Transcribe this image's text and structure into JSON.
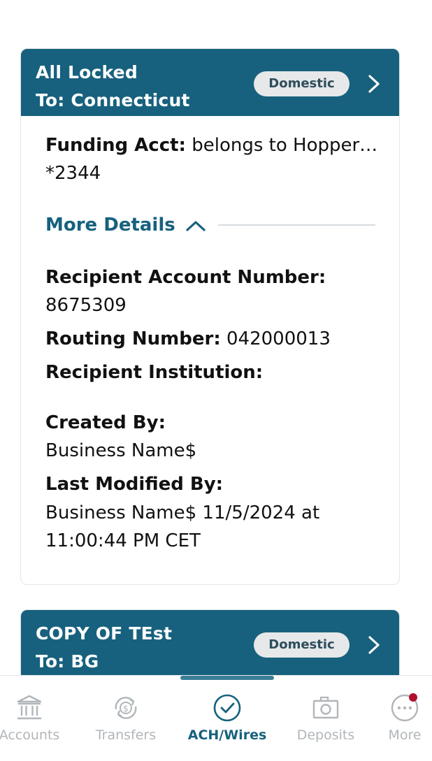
{
  "cards": [
    {
      "title_line1": "All Locked",
      "title_line2": "To: Connecticut",
      "badge": "Domestic",
      "funding_label": "Funding Acct:",
      "funding_value": " belongs to Hopper…",
      "funding_account": "*2344",
      "more_details": "More Details",
      "recipient_account_label": "Recipient Account Number:",
      "recipient_account_value": "8675309",
      "routing_label": "Routing Number:",
      "routing_value": " 042000013",
      "institution_label": "Recipient Institution:",
      "created_by_label": "Created By:",
      "created_by_value": "Business Name$",
      "last_modified_label": "Last Modified By:",
      "last_modified_line1": "Business Name$ 11/5/2024 at",
      "last_modified_line2": "11:00:44 PM CET"
    },
    {
      "title_line1": "COPY OF TEst",
      "title_line2": "To: BG",
      "badge": "Domestic"
    }
  ],
  "tabs": [
    {
      "label": "Accounts",
      "icon": "bank-icon",
      "active": false
    },
    {
      "label": "Transfers",
      "icon": "transfer-icon",
      "active": false
    },
    {
      "label": "ACH/Wires",
      "icon": "check-circle-icon",
      "active": true
    },
    {
      "label": "Deposits",
      "icon": "camera-icon",
      "active": false
    },
    {
      "label": "More",
      "icon": "more-icon",
      "active": false
    }
  ],
  "colors": {
    "header": "#17617e",
    "accent": "#17617e",
    "inactive_tab": "#b1b6ba",
    "notification_dot": "#b0102e"
  }
}
